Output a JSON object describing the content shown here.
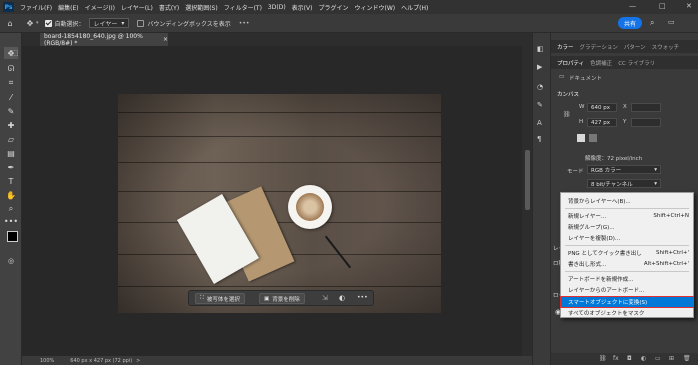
{
  "menubar": {
    "logo": "Ps",
    "items": [
      "ファイル(F)",
      "編集(E)",
      "イメージ(I)",
      "レイヤー(L)",
      "書式(Y)",
      "選択範囲(S)",
      "フィルター(T)",
      "3D(D)",
      "表示(V)",
      "プラグイン",
      "ウィンドウ(W)",
      "ヘルプ(H)"
    ],
    "win_min": "—",
    "win_max": "□",
    "win_close": "✕"
  },
  "options": {
    "auto_select_label": "自動選択：",
    "layer_select": "レイヤー",
    "bbox_label": "バウンディングボックスを表示",
    "more": "•••",
    "share": "共有"
  },
  "document": {
    "tab_title": "board-1854180_640.jpg @ 100% (RGB/8#) *",
    "close": "×"
  },
  "floating_bar": {
    "select_subject": "被写体を選択",
    "remove_bg": "背景を削除",
    "more": "•••"
  },
  "status": {
    "zoom": "100%",
    "info": "640 px x 427 px (72 ppi)",
    "arrow": ">"
  },
  "panel": {
    "top_tabs": [
      "カラー",
      "グラデーション",
      "パターン",
      "スウォッチ"
    ],
    "prop_tabs": [
      "プロパティ",
      "色調補正",
      "CC ライブラリ"
    ],
    "doc_label": "ドキュメント",
    "canvas_title": "カンバス",
    "w_label": "W",
    "w_value": "640 px",
    "h_label": "H",
    "h_value": "427 px",
    "x_label": "X",
    "y_label": "Y",
    "resolution": "解像度：72 pixel/inch",
    "mode_label": "モード",
    "mode_value": "RGB カラー",
    "bit_value": "8 bit/チャンネル",
    "layers_tab": "レイヤー",
    "layer_short1": "ロ種",
    "layer_short2": "ロック"
  },
  "context_menu": {
    "items": [
      {
        "label": "背景からレイヤーへ(B)...",
        "shortcut": ""
      },
      {
        "label": "新規レイヤー...",
        "shortcut": "Shift+Ctrl+N"
      },
      {
        "label": "新規グループ(G)...",
        "shortcut": ""
      },
      {
        "label": "レイヤーを複製(D)...",
        "shortcut": ""
      },
      {
        "label": "PNG としてクイック書き出し",
        "shortcut": "Shift+Ctrl+'"
      },
      {
        "label": "書き出し形式...",
        "shortcut": "Alt+Shift+Ctrl+'"
      },
      {
        "label": "アートボードを新規作成...",
        "shortcut": ""
      },
      {
        "label": "レイヤーからのアートボード...",
        "shortcut": ""
      },
      {
        "label": "スマートオブジェクトに変換(S)",
        "shortcut": ""
      },
      {
        "label": "すべてのオブジェクトをマスク",
        "shortcut": ""
      }
    ]
  }
}
